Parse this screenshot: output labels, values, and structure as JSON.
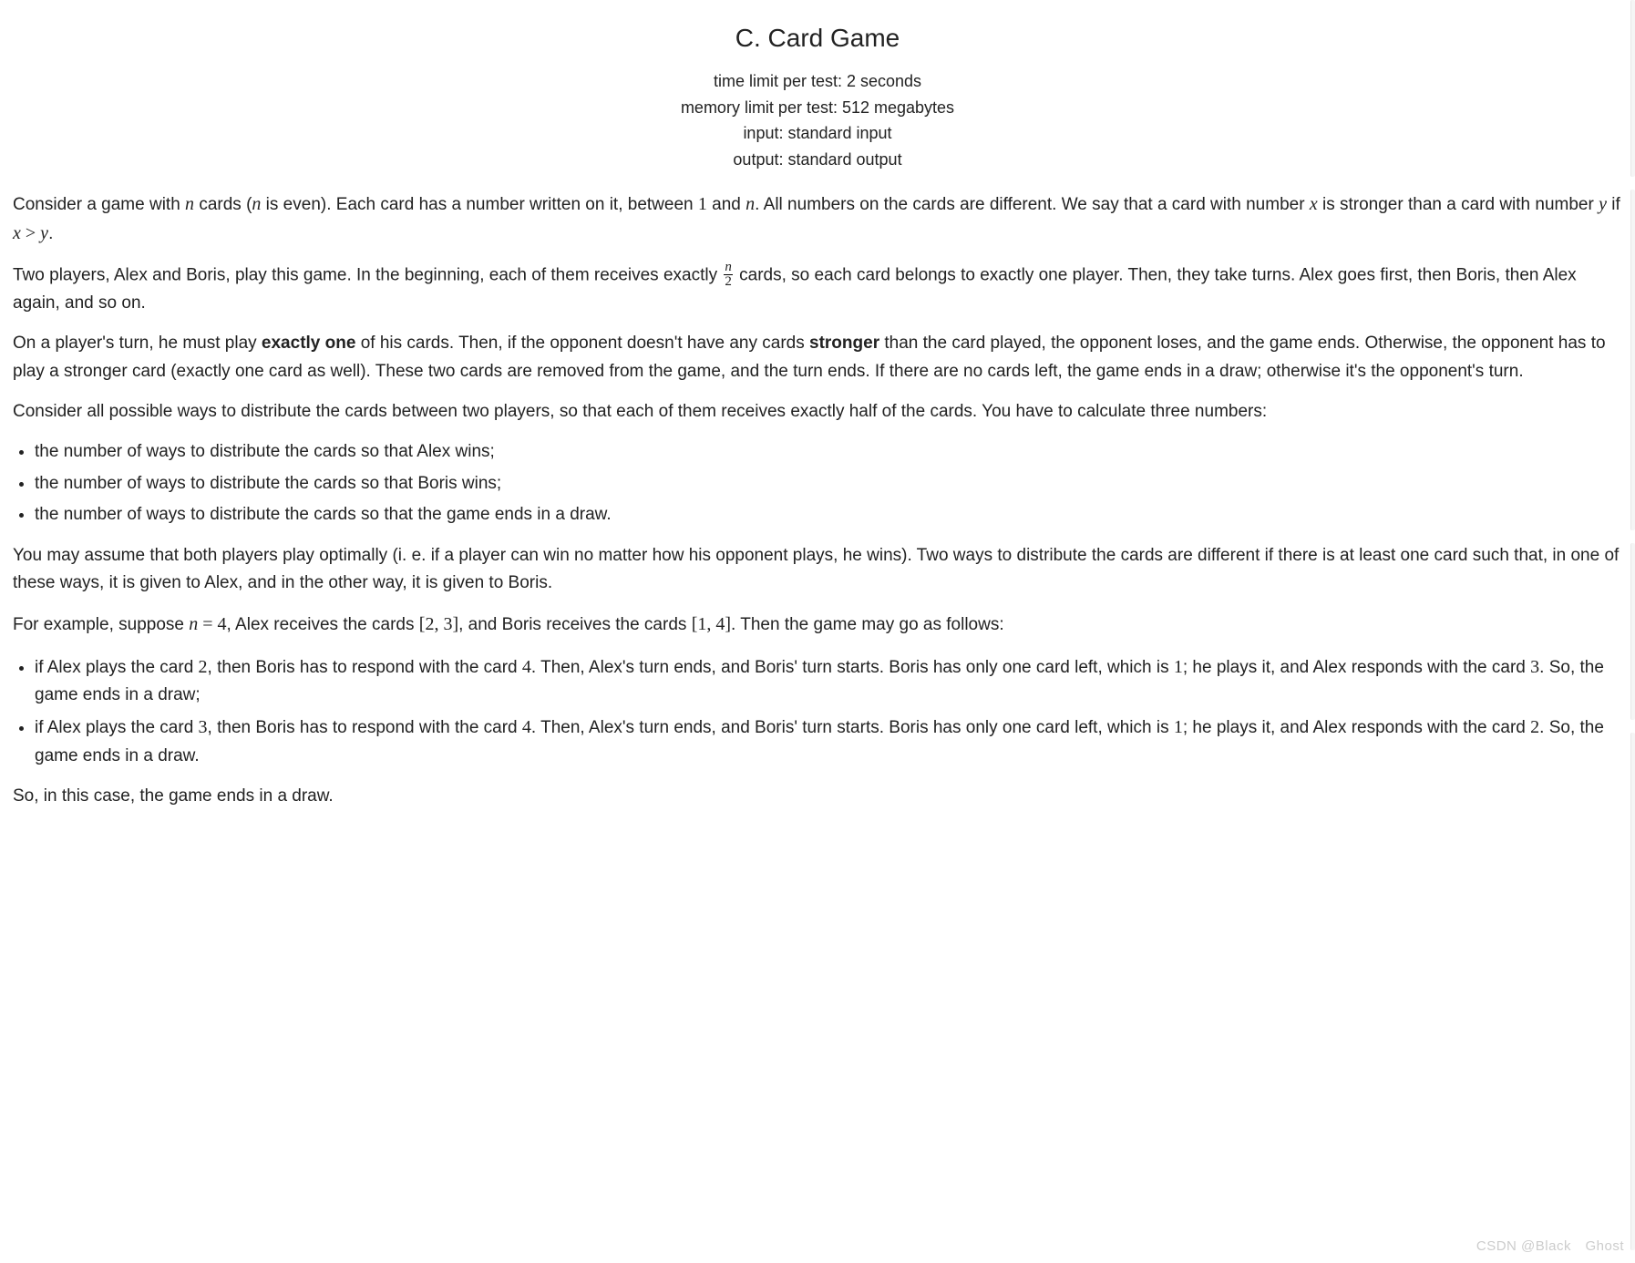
{
  "header": {
    "title": "C. Card Game",
    "time_limit": "time limit per test: 2 seconds",
    "memory_limit": "memory limit per test: 512 megabytes",
    "input": "input: standard input",
    "output": "output: standard output"
  },
  "math": {
    "n": "n",
    "n2": "n",
    "one": "1",
    "x": "x",
    "y": "y",
    "gt": ">",
    "two": "2",
    "half_num": "n",
    "half_den": "2",
    "four": "4",
    "set23_open": "[",
    "set23_a": "2",
    "set23_c": ",",
    "set23_b": "3",
    "set23_close": "]",
    "set14_open": "[",
    "set14_a": "1",
    "set14_c": ",",
    "set14_b": "4",
    "set14_close": "]",
    "c2": "2",
    "c4": "4",
    "c1": "1",
    "c3": "3",
    "eq": "="
  },
  "p1": {
    "t1": "Consider a game with ",
    "t2": " cards (",
    "t3": " is even). Each card has a number written on it, between ",
    "t4": " and ",
    "t5": ". All numbers on the cards are different. We say that a card with number ",
    "t6": " is stronger than a card with number ",
    "t7": " if ",
    "t8": "."
  },
  "p2": {
    "t1": "Two players, Alex and Boris, play this game. In the beginning, each of them receives exactly ",
    "t2": " cards, so each card belongs to exactly one player. Then, they take turns. Alex goes first, then Boris, then Alex again, and so on."
  },
  "p3": {
    "t1": "On a player's turn, he must play ",
    "b1": "exactly one",
    "t2": " of his cards. Then, if the opponent doesn't have any cards ",
    "b2": "stronger",
    "t3": " than the card played, the opponent loses, and the game ends. Otherwise, the opponent has to play a stronger card (exactly one card as well). These two cards are removed from the game, and the turn ends. If there are no cards left, the game ends in a draw; otherwise it's the opponent's turn."
  },
  "p4": "Consider all possible ways to distribute the cards between two players, so that each of them receives exactly half of the cards. You have to calculate three numbers:",
  "list1": {
    "i1": "the number of ways to distribute the cards so that Alex wins;",
    "i2": "the number of ways to distribute the cards so that Boris wins;",
    "i3": "the number of ways to distribute the cards so that the game ends in a draw."
  },
  "p5": "You may assume that both players play optimally (i. e. if a player can win no matter how his opponent plays, he wins). Two ways to distribute the cards are different if there is at least one card such that, in one of these ways, it is given to Alex, and in the other way, it is given to Boris.",
  "p6": {
    "t1": "For example, suppose ",
    "t2": ", Alex receives the cards ",
    "t3": ", and Boris receives the cards ",
    "t4": ". Then the game may go as follows:"
  },
  "list2": {
    "i1": {
      "a": "if Alex plays the card ",
      "b": ", then Boris has to respond with the card ",
      "c": ". Then, Alex's turn ends, and Boris' turn starts. Boris has only one card left, which is ",
      "d": "; he plays it, and Alex responds with the card ",
      "e": ". So, the game ends in a draw;"
    },
    "i2": {
      "a": "if Alex plays the card ",
      "b": ", then Boris has to respond with the card ",
      "c": ". Then, Alex's turn ends, and Boris' turn starts. Boris has only one card left, which is ",
      "d": "; he plays it, and Alex responds with the card ",
      "e": ". So, the game ends in a draw."
    }
  },
  "p7": "So, in this case, the game ends in a draw.",
  "watermark": "CSDN @Black Ghost"
}
